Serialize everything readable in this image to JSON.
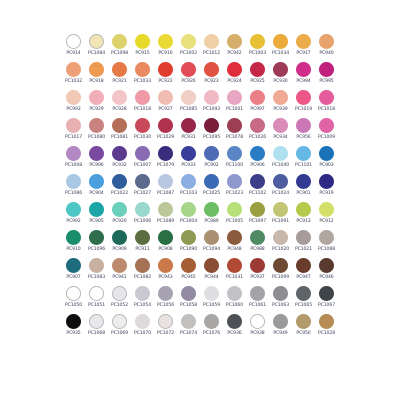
{
  "swatches": [
    [
      {
        "code": "PC914",
        "color": "#ffffff"
      },
      {
        "code": "PC1084",
        "color": "#f2e5b4"
      },
      {
        "code": "PC1098",
        "color": "#ddd36a"
      },
      {
        "code": "PC915",
        "color": "#e6d928"
      },
      {
        "code": "PC916",
        "color": "#ebd934"
      },
      {
        "code": "PC1002",
        "color": "#e8e07c"
      },
      {
        "code": "PC1012",
        "color": "#eecfa6"
      },
      {
        "code": "PC942",
        "color": "#d4ae6a"
      },
      {
        "code": "PC1003",
        "color": "#e8c035"
      },
      {
        "code": "PC1034",
        "color": "#ebaa3a"
      },
      {
        "code": "PC917",
        "color": "#edac4a"
      },
      {
        "code": "PC940",
        "color": "#e8a26c"
      }
    ],
    [
      {
        "code": "PC1032",
        "color": "#eea076"
      },
      {
        "code": "PC918",
        "color": "#ef9a52"
      },
      {
        "code": "PC921",
        "color": "#e67a46"
      },
      {
        "code": "PC1033",
        "color": "#e98a60"
      },
      {
        "code": "PC922",
        "color": "#e03d2e"
      },
      {
        "code": "PC926",
        "color": "#e24e58"
      },
      {
        "code": "PC923",
        "color": "#e05242"
      },
      {
        "code": "PC924",
        "color": "#df2f3c"
      },
      {
        "code": "PC925",
        "color": "#c42846"
      },
      {
        "code": "PC930",
        "color": "#9c3a58"
      },
      {
        "code": "PC994",
        "color": "#cf2e8a"
      },
      {
        "code": "PC995",
        "color": "#c11f7d"
      }
    ],
    [
      {
        "code": "PC993",
        "color": "#f0c8b4"
      },
      {
        "code": "PC929",
        "color": "#f2aeb8"
      },
      {
        "code": "PC928",
        "color": "#f3c4c8"
      },
      {
        "code": "PC1018",
        "color": "#ef9aa6"
      },
      {
        "code": "PC927",
        "color": "#f1bcb2"
      },
      {
        "code": "PC1085",
        "color": "#efcfc6"
      },
      {
        "code": "PC1093",
        "color": "#f0b9c4"
      },
      {
        "code": "PC1001",
        "color": "#e9a6c2"
      },
      {
        "code": "PC997",
        "color": "#ea7f88"
      },
      {
        "code": "PC939",
        "color": "#f0aa94"
      },
      {
        "code": "PC1019",
        "color": "#ec5788"
      },
      {
        "code": "PC1018",
        "color": "#e45c9c"
      }
    ],
    [
      {
        "code": "PC1017",
        "color": "#e9b0b2"
      },
      {
        "code": "PC1080",
        "color": "#c9837e"
      },
      {
        "code": "PC1081",
        "color": "#b56e58"
      },
      {
        "code": "PC1030",
        "color": "#c9485a"
      },
      {
        "code": "PC1029",
        "color": "#b0324e"
      },
      {
        "code": "PC931",
        "color": "#98264a"
      },
      {
        "code": "PC1095",
        "color": "#7a1f3a"
      },
      {
        "code": "PC1078",
        "color": "#9d3f52"
      },
      {
        "code": "PC1026",
        "color": "#c86a86"
      },
      {
        "code": "PC934",
        "color": "#d98cb8"
      },
      {
        "code": "PC956",
        "color": "#cd78b6"
      },
      {
        "code": "PC1009",
        "color": "#e063a6"
      }
    ],
    [
      {
        "code": "PC1008",
        "color": "#b488c4"
      },
      {
        "code": "PC996",
        "color": "#7a4aa0"
      },
      {
        "code": "PC932",
        "color": "#5c3a8e"
      },
      {
        "code": "PC1007",
        "color": "#8a6cb4"
      },
      {
        "code": "PC1079",
        "color": "#3a2c7c"
      },
      {
        "code": "PC933",
        "color": "#3a3e9a"
      },
      {
        "code": "PC902",
        "color": "#4e6cb6"
      },
      {
        "code": "PC1100",
        "color": "#5a86c6"
      },
      {
        "code": "PC906",
        "color": "#2a7cc4"
      },
      {
        "code": "PC1040",
        "color": "#aee0f0"
      },
      {
        "code": "PC1101",
        "color": "#66b8e4"
      },
      {
        "code": "PC903",
        "color": "#1b72b8"
      }
    ],
    [
      {
        "code": "PC1086",
        "color": "#a8c8e4"
      },
      {
        "code": "PC904",
        "color": "#4aa0dc"
      },
      {
        "code": "PC1022",
        "color": "#2f5c9a"
      },
      {
        "code": "PC1027",
        "color": "#5a6a8c"
      },
      {
        "code": "PC1087",
        "color": "#b8c8e0"
      },
      {
        "code": "PC1103",
        "color": "#8caee0"
      },
      {
        "code": "PC1025",
        "color": "#3c6ab6"
      },
      {
        "code": "PC1023",
        "color": "#8e98cc"
      },
      {
        "code": "PC1102",
        "color": "#3c3e8a"
      },
      {
        "code": "PC1024",
        "color": "#4e5ca0"
      },
      {
        "code": "PC901",
        "color": "#313b92"
      },
      {
        "code": "PC919",
        "color": "#2d2a86"
      }
    ],
    [
      {
        "code": "PC992",
        "color": "#4ec6c6"
      },
      {
        "code": "PC905",
        "color": "#1aa6a6"
      },
      {
        "code": "PC920",
        "color": "#6ad0bc"
      },
      {
        "code": "PC1006",
        "color": "#98d8ce"
      },
      {
        "code": "PC1089",
        "color": "#bcc89a"
      },
      {
        "code": "PC1004",
        "color": "#a6d68a"
      },
      {
        "code": "PC989",
        "color": "#6cbe64"
      },
      {
        "code": "PC1005",
        "color": "#b8e07a"
      },
      {
        "code": "PC1097",
        "color": "#9aa042"
      },
      {
        "code": "PC1091",
        "color": "#c2c674"
      },
      {
        "code": "PC913",
        "color": "#b6c94c"
      },
      {
        "code": "PC912",
        "color": "#d2e06a"
      }
    ],
    [
      {
        "code": "PC910",
        "color": "#1a8e6a"
      },
      {
        "code": "PC1096",
        "color": "#2e6e4c"
      },
      {
        "code": "PC909",
        "color": "#1e6a5a"
      },
      {
        "code": "PC911",
        "color": "#5a6e42"
      },
      {
        "code": "PC908",
        "color": "#2a6e44"
      },
      {
        "code": "PC1090",
        "color": "#8e9a52"
      },
      {
        "code": "PC1094",
        "color": "#a89070"
      },
      {
        "code": "PC948",
        "color": "#8c5a3c"
      },
      {
        "code": "PC988",
        "color": "#4e8a64"
      },
      {
        "code": "PC1020",
        "color": "#c8b8ac"
      },
      {
        "code": "PC1021",
        "color": "#a89c9a"
      },
      {
        "code": "PC1088",
        "color": "#b2a7a0"
      }
    ],
    [
      {
        "code": "PC907",
        "color": "#1e6c7e"
      },
      {
        "code": "PC1083",
        "color": "#c8b0a0"
      },
      {
        "code": "PC941",
        "color": "#be8a6e"
      },
      {
        "code": "PC1082",
        "color": "#a67256"
      },
      {
        "code": "PC943",
        "color": "#c9794a"
      },
      {
        "code": "PC945",
        "color": "#a55e34"
      },
      {
        "code": "PC944",
        "color": "#8a4e36"
      },
      {
        "code": "PC1031",
        "color": "#b04a34"
      },
      {
        "code": "PC937",
        "color": "#9c3a36"
      },
      {
        "code": "PC1099",
        "color": "#6e4a34"
      },
      {
        "code": "PC947",
        "color": "#6a3c2c"
      },
      {
        "code": "PC946",
        "color": "#5a3a2e"
      }
    ],
    [
      {
        "code": "PC1050",
        "color": "#ffffff"
      },
      {
        "code": "PC1051",
        "color": "#ffffff"
      },
      {
        "code": "PC1052",
        "color": "#e6e6ea"
      },
      {
        "code": "PC1054",
        "color": "#c9c7cf"
      },
      {
        "code": "PC1056",
        "color": "#a8a3b2"
      },
      {
        "code": "PC1058",
        "color": "#938aa4"
      },
      {
        "code": "PC1059",
        "color": "#dfdfe2"
      },
      {
        "code": "PC1060",
        "color": "#c2c2c6"
      },
      {
        "code": "PC1061",
        "color": "#a4a4a8"
      },
      {
        "code": "PC1063",
        "color": "#8e8e92"
      },
      {
        "code": "PC1065",
        "color": "#5f6468"
      },
      {
        "code": "PC1067",
        "color": "#3e4448"
      }
    ],
    [
      {
        "code": "PC935",
        "color": "#0e0e0e"
      },
      {
        "code": "PC1068",
        "color": "#e8e8ec"
      },
      {
        "code": "PC1069",
        "color": "#ededee"
      },
      {
        "code": "PC1070",
        "color": "#ddd8da"
      },
      {
        "code": "PC1072",
        "color": "#e8e2e0"
      },
      {
        "code": "PC1074",
        "color": "#c2bfbf"
      },
      {
        "code": "PC1076",
        "color": "#a8a7a6"
      },
      {
        "code": "PC936",
        "color": "#4e5256"
      },
      {
        "code": "PC938",
        "color": "#ffffff"
      },
      {
        "code": "PC949",
        "color": "#9a9a9a"
      },
      {
        "code": "PC950",
        "color": "#b29a6a"
      },
      {
        "code": "PC1028",
        "color": "#b68c54"
      }
    ]
  ]
}
